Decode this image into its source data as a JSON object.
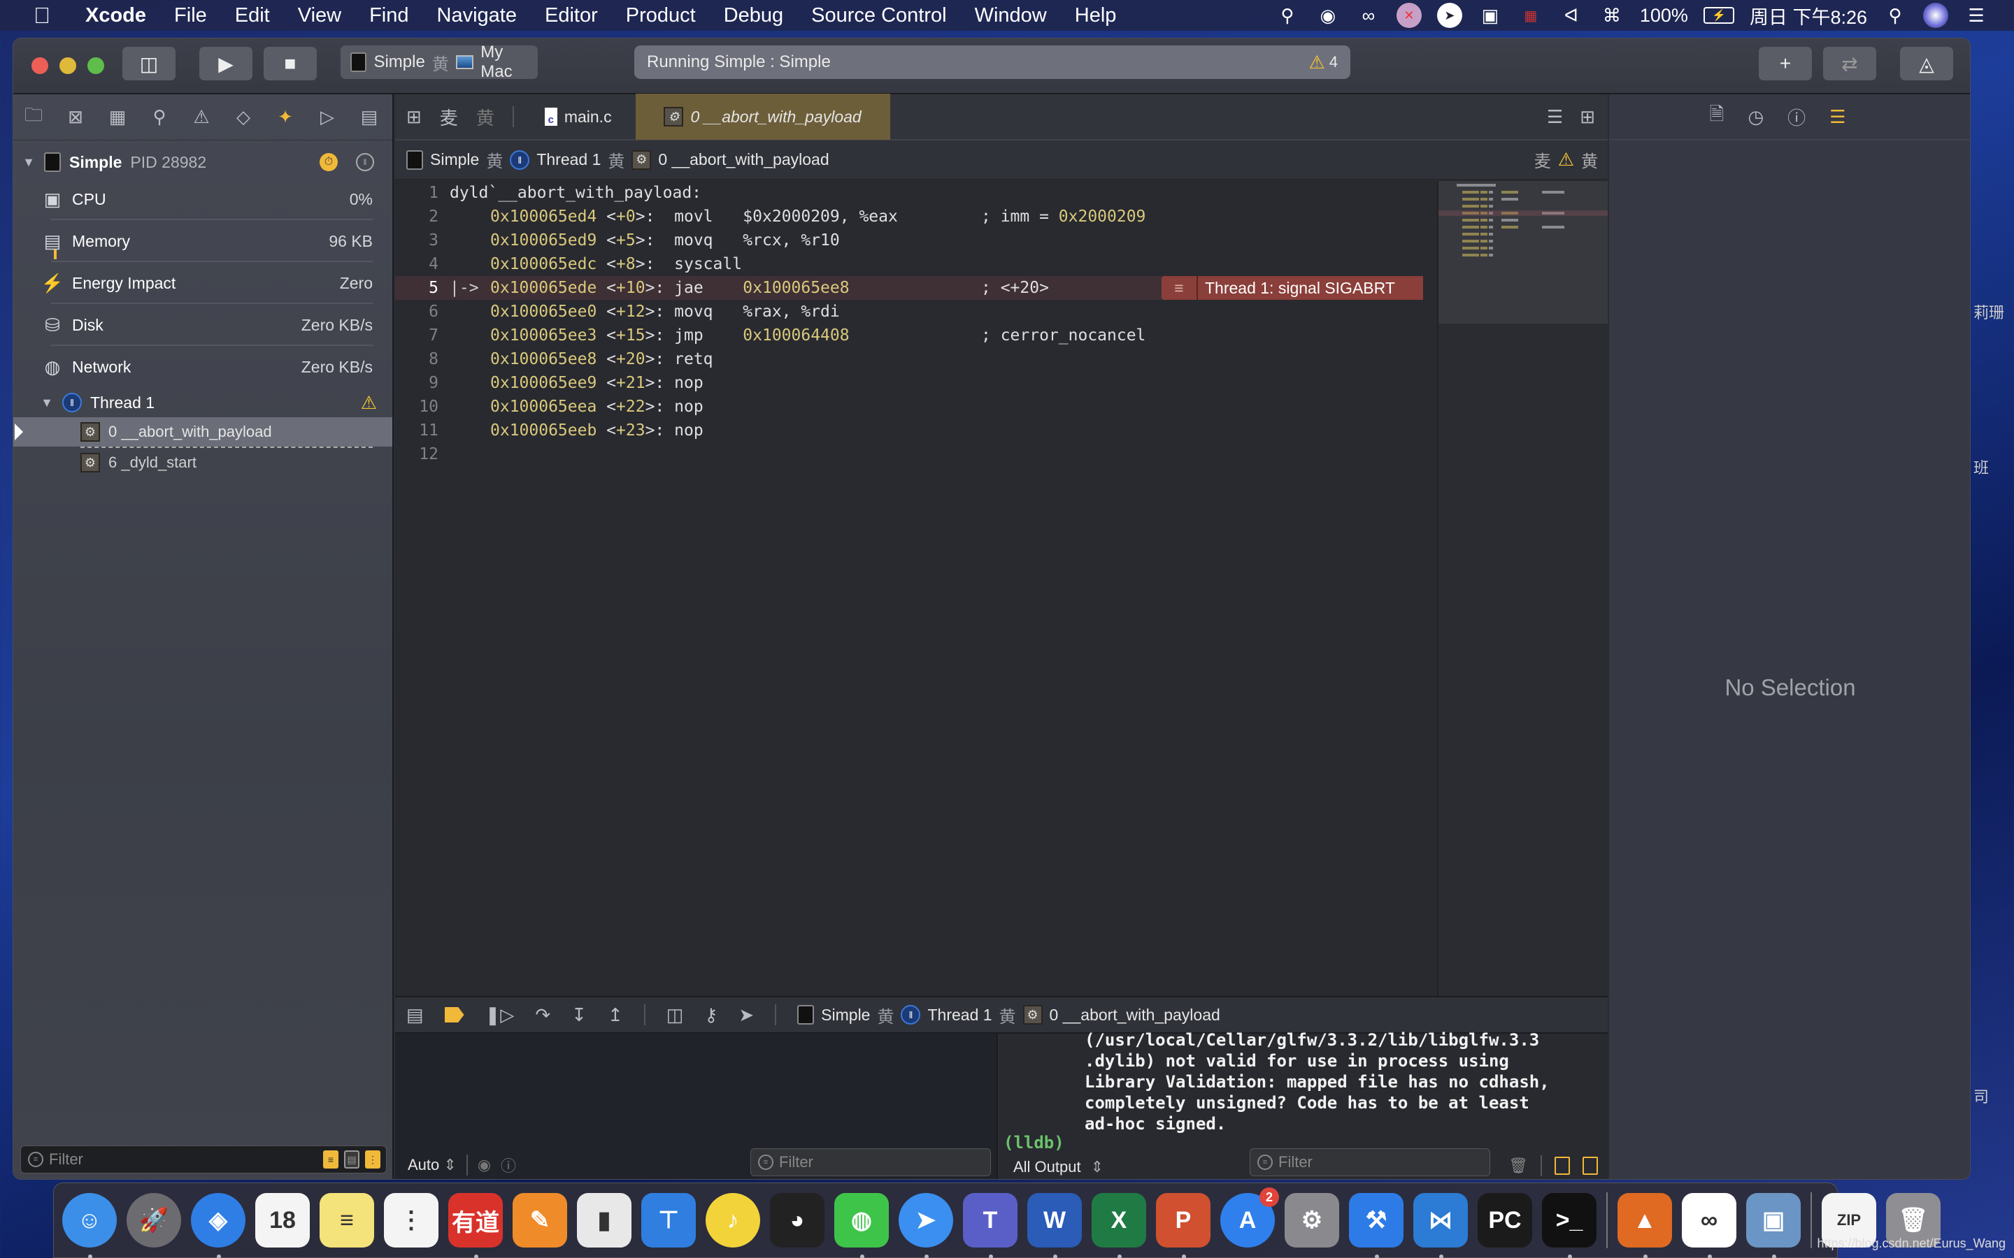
{
  "menubar": {
    "apple_icon": "apple-icon",
    "app_name": "Xcode",
    "items": [
      "File",
      "Edit",
      "View",
      "Find",
      "Navigate",
      "Editor",
      "Product",
      "Debug",
      "Source Control",
      "Window",
      "Help"
    ],
    "status_icons": [
      "qq-search-icon",
      "wechat-icon",
      "creative-cloud-icon",
      "app-status-icon",
      "dingtalk-icon",
      "display-icon",
      "uk-flag-icon",
      "bluetooth-icon",
      "wifi-icon"
    ],
    "battery": "100%",
    "clock": "周日 下午8:26"
  },
  "toolbar": {
    "scheme": "Simple",
    "destination": "My Mac",
    "activity": "Running Simple : Simple",
    "warning_count": "4"
  },
  "navigator": {
    "process": {
      "name": "Simple",
      "pid": "PID 28982"
    },
    "gauges": [
      {
        "label": "CPU",
        "value": "0%",
        "icon": "cpu-icon"
      },
      {
        "label": "Memory",
        "value": "96 KB",
        "icon": "memory-icon"
      },
      {
        "label": "Energy Impact",
        "value": "Zero",
        "icon": "energy-icon"
      },
      {
        "label": "Disk",
        "value": "Zero KB/s",
        "icon": "disk-icon"
      },
      {
        "label": "Network",
        "value": "Zero KB/s",
        "icon": "network-icon"
      }
    ],
    "thread": {
      "label": "Thread 1"
    },
    "frames": [
      {
        "label": "0 __abort_with_payload",
        "selected": true
      },
      {
        "label": "6 _dyld_start",
        "selected": false
      }
    ],
    "filter_placeholder": "Filter"
  },
  "editor": {
    "tabs": [
      {
        "label": "main.c",
        "active": false
      },
      {
        "label": "0 __abort_with_payload",
        "active": true
      }
    ],
    "jumpbar": [
      "Simple",
      "Thread 1",
      "0 __abort_with_payload"
    ],
    "lines": [
      {
        "n": "1",
        "addr": "",
        "off": "",
        "op": "dyld`__abort_with_payload:",
        "args": "",
        "comment": "",
        "commentNum": ""
      },
      {
        "n": "2",
        "addr": "0x100065ed4",
        "off": "+0",
        "op": "movl",
        "args": "$0x2000209, %eax",
        "comment": "; imm = ",
        "commentNum": "0x2000209"
      },
      {
        "n": "3",
        "addr": "0x100065ed9",
        "off": "+5",
        "op": "movq",
        "args": "%rcx, %r10",
        "comment": "",
        "commentNum": ""
      },
      {
        "n": "4",
        "addr": "0x100065edc",
        "off": "+8",
        "op": "syscall",
        "args": "",
        "comment": "",
        "commentNum": ""
      },
      {
        "n": "5",
        "addr": "0x100065ede",
        "off": "+10",
        "op": "jae",
        "args": "0x100065ee8",
        "comment": "; <+20>",
        "commentNum": "",
        "current": true
      },
      {
        "n": "6",
        "addr": "0x100065ee0",
        "off": "+12",
        "op": "movq",
        "args": "%rax, %rdi",
        "comment": "",
        "commentNum": ""
      },
      {
        "n": "7",
        "addr": "0x100065ee3",
        "off": "+15",
        "op": "jmp",
        "args": "0x100064408",
        "comment": "; cerror_nocancel",
        "commentNum": ""
      },
      {
        "n": "8",
        "addr": "0x100065ee8",
        "off": "+20",
        "op": "retq",
        "args": "",
        "comment": "",
        "commentNum": ""
      },
      {
        "n": "9",
        "addr": "0x100065ee9",
        "off": "+21",
        "op": "nop",
        "args": "",
        "comment": "",
        "commentNum": ""
      },
      {
        "n": "10",
        "addr": "0x100065eea",
        "off": "+22",
        "op": "nop",
        "args": "",
        "comment": "",
        "commentNum": ""
      },
      {
        "n": "11",
        "addr": "0x100065eeb",
        "off": "+23",
        "op": "nop",
        "args": "",
        "comment": "",
        "commentNum": ""
      },
      {
        "n": "12",
        "addr": "",
        "off": "",
        "op": "",
        "args": "",
        "comment": "",
        "commentNum": ""
      }
    ],
    "error_annotation": "Thread 1: signal SIGABRT"
  },
  "debugbar": {
    "crumbs": [
      "Simple",
      "Thread 1",
      "0 __abort_with_payload"
    ]
  },
  "variables": {
    "scope": "Auto",
    "filter_placeholder": "Filter"
  },
  "console": {
    "lines": [
      "(/usr/local/Cellar/glfw/3.3.2/lib/libglfw.3.3",
      ".dylib) not valid for use in process using",
      "Library Validation: mapped file has no cdhash,",
      "completely unsigned? Code has to be at least",
      "ad-hoc signed."
    ],
    "prompt": "(lldb)",
    "output_mode": "All Output",
    "filter_placeholder": "Filter"
  },
  "inspector": {
    "empty_text": "No Selection"
  },
  "dock": {
    "apps": [
      {
        "name": "finder",
        "glyph": "☺",
        "bg": "#3b8fe8",
        "running": true
      },
      {
        "name": "launchpad",
        "glyph": "🚀",
        "bg": "#6c6c70",
        "running": false
      },
      {
        "name": "safari",
        "glyph": "◈",
        "bg": "#2e7ee6",
        "running": true
      },
      {
        "name": "calendar",
        "glyph": "18",
        "bg": "#f4f4f4",
        "running": false
      },
      {
        "name": "notes",
        "glyph": "≡",
        "bg": "#f4e27a",
        "running": false
      },
      {
        "name": "reminders",
        "glyph": "⋮",
        "bg": "#f4f4f4",
        "running": false
      },
      {
        "name": "youdao-dict",
        "glyph": "有道",
        "bg": "#d9322b",
        "running": true
      },
      {
        "name": "pages",
        "glyph": "✎",
        "bg": "#f08b2a",
        "running": false
      },
      {
        "name": "numbers",
        "glyph": "▮",
        "bg": "#e8e8e8",
        "running": false
      },
      {
        "name": "keynote",
        "glyph": "⊤",
        "bg": "#2f7ee0",
        "running": false
      },
      {
        "name": "qq-music",
        "glyph": "♪",
        "bg": "#f2d33a",
        "running": false
      },
      {
        "name": "qq",
        "glyph": "◕",
        "bg": "#222",
        "running": false
      },
      {
        "name": "wechat",
        "glyph": "◍",
        "bg": "#3fc44a",
        "running": true
      },
      {
        "name": "dingtalk",
        "glyph": "➤",
        "bg": "#3a8ff0",
        "running": true
      },
      {
        "name": "teams",
        "glyph": "T",
        "bg": "#5a5fc8",
        "running": true
      },
      {
        "name": "word",
        "glyph": "W",
        "bg": "#2a5cb8",
        "running": true
      },
      {
        "name": "excel",
        "glyph": "X",
        "bg": "#1f7a44",
        "running": true
      },
      {
        "name": "powerpoint",
        "glyph": "P",
        "bg": "#d05030",
        "running": true
      },
      {
        "name": "app-store",
        "glyph": "A",
        "bg": "#2f80ed",
        "running": false,
        "badge": "2"
      },
      {
        "name": "system-preferences",
        "glyph": "⚙",
        "bg": "#8a8a8e",
        "running": false
      },
      {
        "name": "xcode",
        "glyph": "⚒",
        "bg": "#2d7be6",
        "running": true
      },
      {
        "name": "vscode",
        "glyph": "⋈",
        "bg": "#2c7bd4",
        "running": true
      },
      {
        "name": "pycharm",
        "glyph": "PC",
        "bg": "#1b1b1b",
        "running": false
      },
      {
        "name": "terminal",
        "glyph": ">_",
        "bg": "#111",
        "running": true
      },
      {
        "name": "matlab",
        "glyph": "▲",
        "bg": "#e06a22",
        "running": true
      },
      {
        "name": "baidu-netdisk",
        "glyph": "∞",
        "bg": "#ffffff",
        "running": true
      },
      {
        "name": "preview",
        "glyph": "▣",
        "bg": "#6b95c4",
        "running": true
      },
      {
        "name": "zip-archive",
        "glyph": "ZIP",
        "bg": "#f4f4f4",
        "running": false
      },
      {
        "name": "trash",
        "glyph": "🗑",
        "bg": "#8e8e93",
        "running": false
      }
    ]
  },
  "watermark": "https://blog.csdn.net/Eurus_Wang",
  "desktop_labels": [
    "莉珊",
    "班",
    "司"
  ]
}
